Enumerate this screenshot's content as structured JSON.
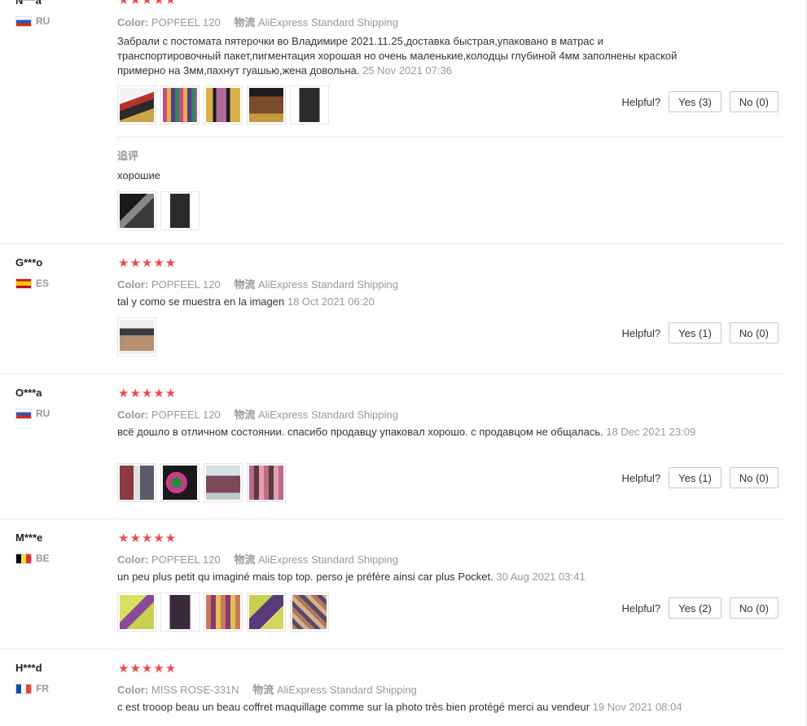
{
  "labels": {
    "color_label": "Color:",
    "shipping_label": "物流",
    "helpful_label": "Helpful?",
    "followup_label": "追评"
  },
  "reviews": [
    {
      "user": "N***a",
      "country": "RU",
      "stars": "★★★★★",
      "color": "POPFEEL 120",
      "shipping": "AliExpress Standard Shipping",
      "text": "Забрали с постомата пятерочки во Владимире 2021.11.25,доставка быстрая,упаковано в матрас и транспортировочный пакет,пигментация хорошая но очень маленькие,колодцы глубиной 4мм заполнены краской примерно на 3мм,пахнут гуашью,жена довольна.",
      "date": "25 Nov 2021 07:36",
      "yes": "Yes (3)",
      "no": "No (0)",
      "followup_text": "хорошие"
    },
    {
      "user": "G***o",
      "country": "ES",
      "stars": "★★★★★",
      "color": "POPFEEL 120",
      "shipping": "AliExpress Standard Shipping",
      "text": "tal y como se muestra en la imagen",
      "date": "18 Oct 2021 06:20",
      "yes": "Yes (1)",
      "no": "No (0)"
    },
    {
      "user": "O***a",
      "country": "RU",
      "stars": "★★★★★",
      "color": "POPFEEL 120",
      "shipping": "AliExpress Standard Shipping",
      "text": "всё дошло в отличном состоянии. спасибо продавцу упаковал хорошо. с продавцом не общалась.",
      "date": "18 Dec 2021 23:09",
      "yes": "Yes (1)",
      "no": "No (0)"
    },
    {
      "user": "M***e",
      "country": "BE",
      "stars": "★★★★★",
      "color": "POPFEEL 120",
      "shipping": "AliExpress Standard Shipping",
      "text": "un peu plus petit qu imaginé mais top top. perso je préfère ainsi car plus Pocket.",
      "date": "30 Aug 2021 03:41",
      "yes": "Yes (2)",
      "no": "No (0)"
    },
    {
      "user": "H***d",
      "country": "FR",
      "stars": "★★★★★",
      "color": "MISS ROSE-331N",
      "shipping": "AliExpress Standard Shipping",
      "text": "c est trooop beau un beau coffret maquillage comme sur la photo très bien protégé merci au vendeur",
      "date": "19 Nov 2021 08:04"
    }
  ],
  "colors": {
    "star": "#f0494d",
    "muted_text": "#999999",
    "body_text": "#333333",
    "divider": "#e8e8e8"
  }
}
